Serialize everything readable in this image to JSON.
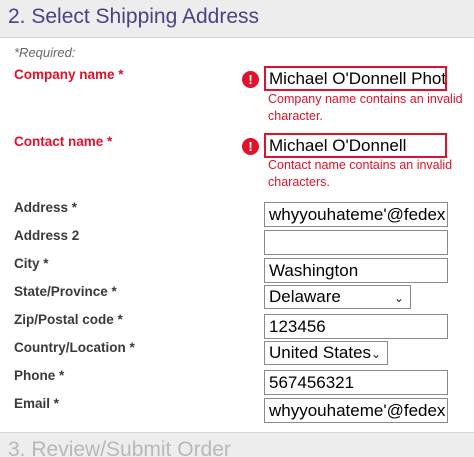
{
  "header": {
    "title": "2. Select Shipping Address"
  },
  "required_note": "*Required:",
  "company": {
    "label": "Company name *",
    "value": "Michael O'Donnell Photo",
    "error": "Company name contains an invalid character.",
    "icon": "exclamation-circle-icon"
  },
  "contact": {
    "label": "Contact name *",
    "value": "Michael O'Donnell",
    "error": "Contact name contains an invalid characters.",
    "icon": "exclamation-circle-icon"
  },
  "address": {
    "label": "Address *",
    "value": "whyyouhateme'@fedex"
  },
  "address2": {
    "label": "Address 2",
    "value": ""
  },
  "city": {
    "label": "City *",
    "value": "Washington"
  },
  "state": {
    "label": "State/Province *",
    "value": "Delaware"
  },
  "zip": {
    "label": "Zip/Postal code *",
    "value": "123456"
  },
  "country": {
    "label": "Country/Location *",
    "value": "United States"
  },
  "phone": {
    "label": "Phone *",
    "value": "567456321"
  },
  "email": {
    "label": "Email *",
    "value": "whyyouhateme'@fedex"
  },
  "next_section": {
    "title": "3. Review/Submit Order"
  },
  "colors": {
    "error": "#e0112b",
    "heading": "#4e3f86",
    "header_bg": "#ededed"
  }
}
